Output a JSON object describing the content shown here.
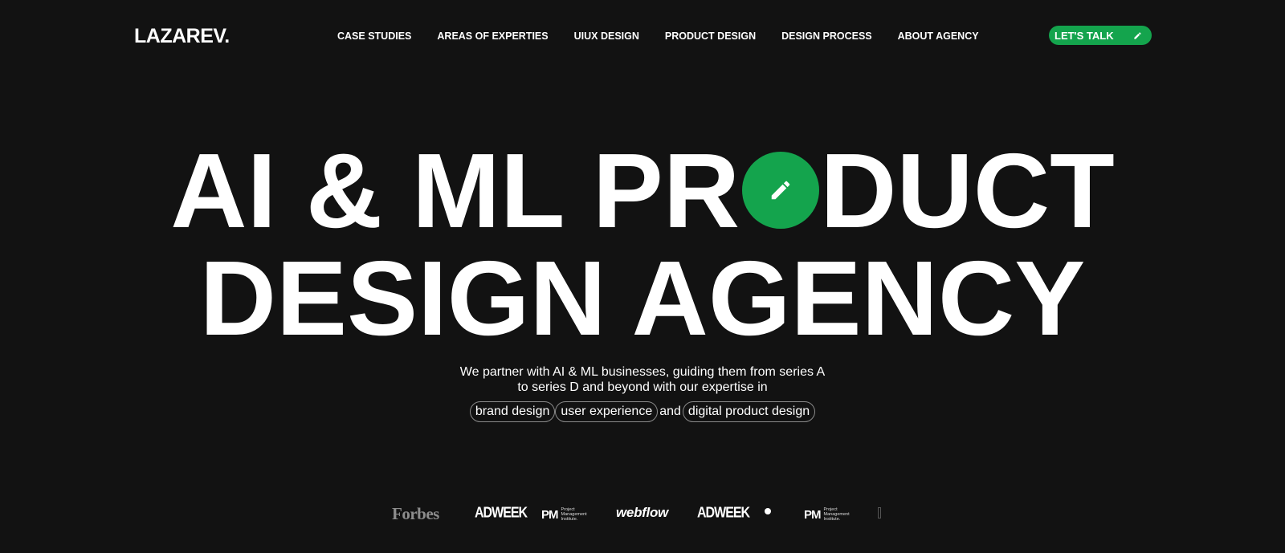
{
  "header": {
    "logo": "LAZAREV.",
    "nav": [
      "CASE STUDIES",
      "AREAS OF EXPERTIES",
      "UIUX DESIGN",
      "PRODUCT DESIGN",
      "DESIGN PROCESS",
      "ABOUT AGENCY"
    ],
    "cta_label": "LET'S TALK",
    "cta_icon": "pencil-icon"
  },
  "hero": {
    "line1_part1": "AI & ML PR",
    "line1_part2": "DUCT",
    "line2": "DESIGN AGENCY",
    "o_icon": "pencil-icon",
    "subtitle_line1": "We partner with AI & ML businesses, guiding them from series A",
    "subtitle_line2": "to series D and beyond with our expertise in",
    "pills": [
      "brand design",
      "user experience",
      "digital product design"
    ],
    "pill_connector": "and"
  },
  "press_logos": {
    "forbes": "Forbes",
    "adweek": "ADWEEK",
    "pmi_mark": "PM",
    "pmi_text": [
      "Project",
      "Management",
      "Institute."
    ],
    "webflow": "webflow"
  },
  "colors": {
    "background": "#121212",
    "accent": "#14a44d",
    "text": "#ffffff"
  }
}
